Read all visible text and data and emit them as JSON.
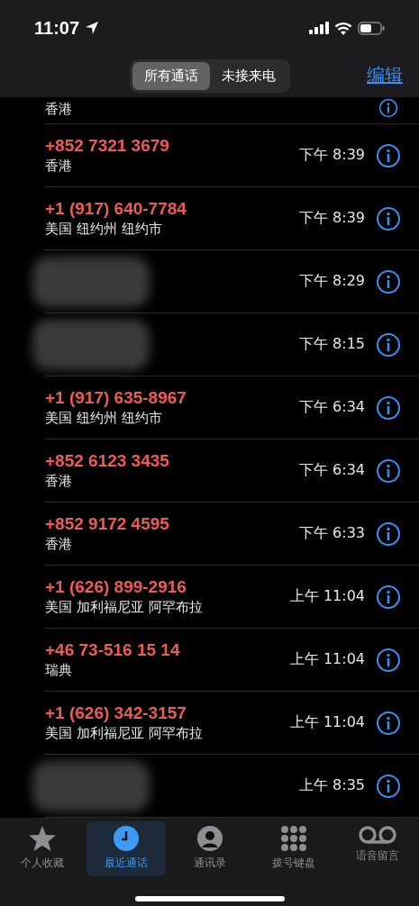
{
  "status_bar": {
    "time": "11:07"
  },
  "segments": [
    {
      "label": "所有通话",
      "selected": true
    },
    {
      "label": "未接来电",
      "selected": false
    }
  ],
  "edit_button": "编辑",
  "partial_row": {
    "location": "香港"
  },
  "calls": [
    {
      "kind": "number",
      "number": "+852 7321 3679",
      "location": "香港",
      "time": "下午 8:39",
      "missed": true
    },
    {
      "kind": "number",
      "number": "+1 (917) 640-7784",
      "location": "美国 纽约州 纽约市",
      "time": "下午 8:39",
      "missed": true
    },
    {
      "kind": "redacted",
      "time": "下午 8:29"
    },
    {
      "kind": "redacted",
      "time": "下午 8:15"
    },
    {
      "kind": "number",
      "number": "+1 (917) 635-8967",
      "location": "美国 纽约州 纽约市",
      "time": "下午 6:34",
      "missed": true
    },
    {
      "kind": "number",
      "number": "+852 6123 3435",
      "location": "香港",
      "time": "下午 6:34",
      "missed": true
    },
    {
      "kind": "number",
      "number": "+852 9172 4595",
      "location": "香港",
      "time": "下午 6:33",
      "missed": true
    },
    {
      "kind": "number",
      "number": "+1 (626) 899-2916",
      "location": "美国 加利福尼亚 阿罕布拉",
      "time": "上午 11:04",
      "missed": true
    },
    {
      "kind": "number",
      "number": "+46 73-516 15 14",
      "location": "瑞典",
      "time": "上午 11:04",
      "missed": true
    },
    {
      "kind": "number",
      "number": "+1 (626) 342-3157",
      "location": "美国 加利福尼亚 阿罕布拉",
      "time": "上午 11:04",
      "missed": true
    },
    {
      "kind": "redacted",
      "time": "上午 8:35"
    }
  ],
  "tab_bar": [
    {
      "kind": "star",
      "label": "个人收藏",
      "selected": false
    },
    {
      "kind": "clock",
      "label": "最近通话",
      "selected": true
    },
    {
      "kind": "person",
      "label": "通讯录",
      "selected": false
    },
    {
      "kind": "keypad",
      "label": "拨号键盘",
      "selected": false
    },
    {
      "kind": "voicemail",
      "label": "语音留言",
      "selected": false
    }
  ]
}
